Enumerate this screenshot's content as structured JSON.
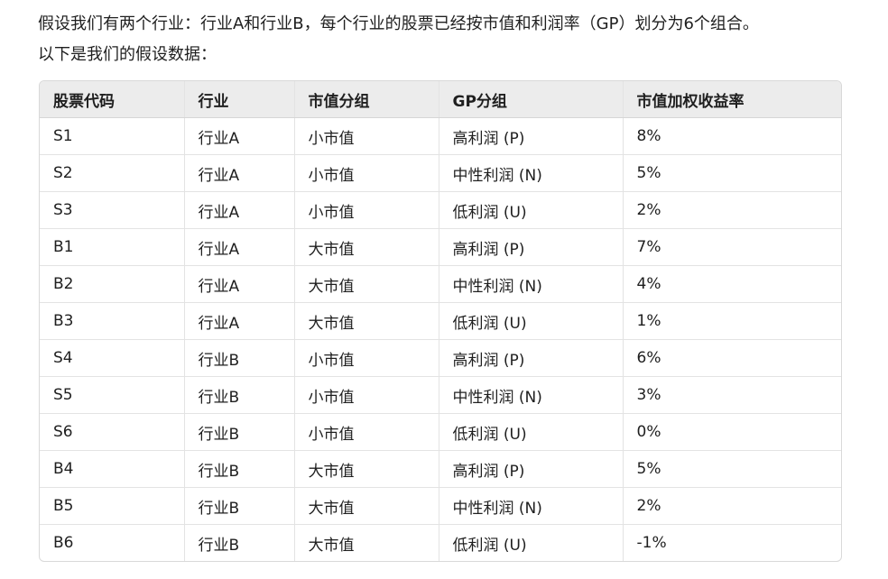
{
  "intro": {
    "line1": "假设我们有两个行业：行业A和行业B，每个行业的股票已经按市值和利润率（GP）划分为6个组合。",
    "line2": "以下是我们的假设数据："
  },
  "table": {
    "headers": [
      "股票代码",
      "行业",
      "市值分组",
      "GP分组",
      "市值加权收益率"
    ],
    "rows": [
      [
        "S1",
        "行业A",
        "小市值",
        "高利润 (P)",
        "8%"
      ],
      [
        "S2",
        "行业A",
        "小市值",
        "中性利润 (N)",
        "5%"
      ],
      [
        "S3",
        "行业A",
        "小市值",
        "低利润 (U)",
        "2%"
      ],
      [
        "B1",
        "行业A",
        "大市值",
        "高利润 (P)",
        "7%"
      ],
      [
        "B2",
        "行业A",
        "大市值",
        "中性利润 (N)",
        "4%"
      ],
      [
        "B3",
        "行业A",
        "大市值",
        "低利润 (U)",
        "1%"
      ],
      [
        "S4",
        "行业B",
        "小市值",
        "高利润 (P)",
        "6%"
      ],
      [
        "S5",
        "行业B",
        "小市值",
        "中性利润 (N)",
        "3%"
      ],
      [
        "S6",
        "行业B",
        "小市值",
        "低利润 (U)",
        "0%"
      ],
      [
        "B4",
        "行业B",
        "大市值",
        "高利润 (P)",
        "5%"
      ],
      [
        "B5",
        "行业B",
        "大市值",
        "中性利润 (N)",
        "2%"
      ],
      [
        "B6",
        "行业B",
        "大市值",
        "低利润 (U)",
        "-1%"
      ]
    ]
  }
}
